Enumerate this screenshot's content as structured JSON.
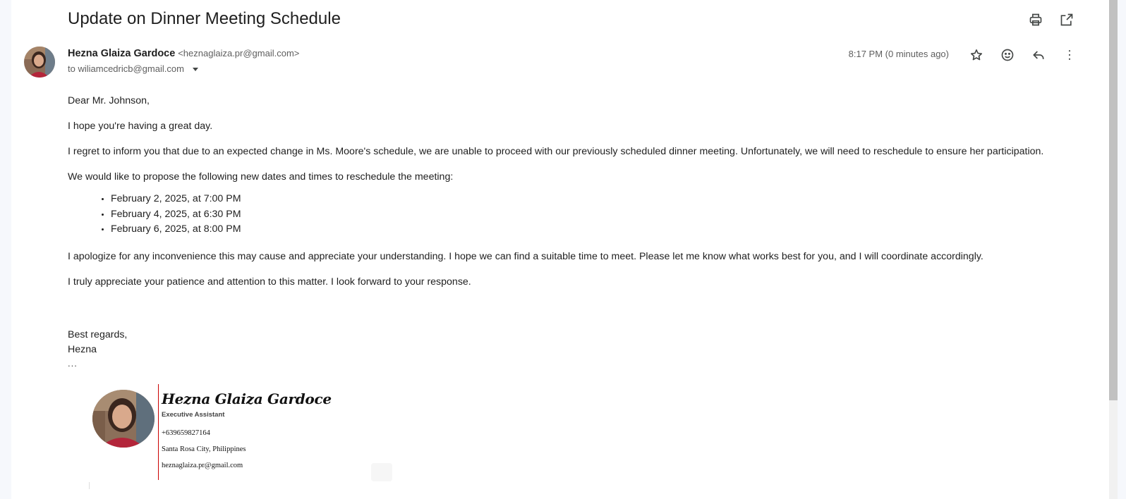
{
  "email": {
    "subject": "Update on Dinner Meeting Schedule",
    "sender_name": "Hezna Glaiza Gardoce",
    "sender_email": "<heznaglaiza.pr@gmail.com>",
    "to_line": "to wiliamcedricb@gmail.com",
    "time": "8:17 PM (0 minutes ago)",
    "greeting": "Dear Mr. Johnson,",
    "p1": "I hope you're having a great day.",
    "p2": "I regret to inform you that due to an expected change in Ms. Moore's schedule, we are unable to proceed with our previously scheduled dinner meeting. Unfortunately, we will need to reschedule to ensure her participation.",
    "p3": "We would like to propose the following new dates and times to reschedule the meeting:",
    "dates": [
      "February 2, 2025, at 7:00 PM",
      "February 4, 2025, at 6:30 PM",
      "February 6, 2025, at 8:00 PM"
    ],
    "p4": "I apologize for any inconvenience this may cause and appreciate your understanding. I hope we can find a suitable time to meet. Please let me know what works best for you, and I will coordinate accordingly.",
    "p5": "I truly appreciate your patience and attention to this matter. I look forward to your response.",
    "closing": "Best regards,",
    "signoff_name": "Hezna",
    "trimmed": "..."
  },
  "signature": {
    "name": "Hezna Glaiza Gardoce",
    "title": "Executive Assistant",
    "phone": "+639659827164",
    "location": "Santa Rosa City, Philippines",
    "email": "heznaglaiza.pr@gmail.com"
  },
  "icons": {
    "print": "print-icon",
    "open_new": "open-in-new-window-icon",
    "star": "star-icon",
    "emoji": "emoji-reaction-icon",
    "reply": "reply-icon",
    "more": "more-vertical-icon"
  },
  "colors": {
    "signature_rule": "#cc0000",
    "background": "#f6f8fc"
  }
}
